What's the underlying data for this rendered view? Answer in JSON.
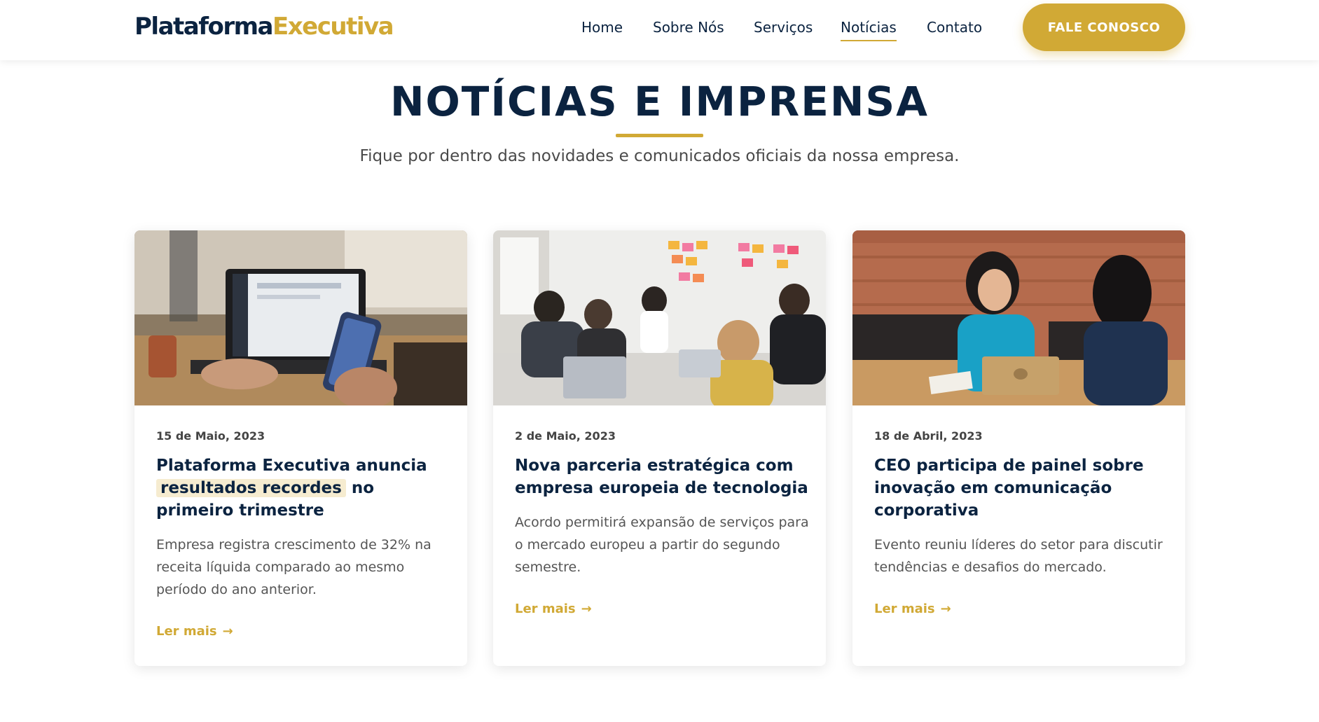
{
  "header": {
    "logo_part1": "Plataforma",
    "logo_part2": "Executiva",
    "nav": [
      {
        "label": "Home"
      },
      {
        "label": "Sobre Nós"
      },
      {
        "label": "Serviços"
      },
      {
        "label": "Notícias",
        "active": true
      },
      {
        "label": "Contato"
      }
    ],
    "cta_label": "FALE CONOSCO"
  },
  "hero": {
    "title": "NOTÍCIAS E IMPRENSA",
    "subtitle": "Fique por dentro das novidades e comunicados oficiais da nossa empresa."
  },
  "cards": [
    {
      "date": "15 de Maio, 2023",
      "headline_before": "Plataforma Executiva anuncia",
      "headline_highlight": "resultados recordes",
      "headline_after": "no primeiro trimestre",
      "excerpt": "Empresa registra crescimento de 32% na receita líquida comparado ao mesmo período do ano anterior.",
      "read_more": "Ler mais",
      "arrow_icon": "→"
    },
    {
      "date": "2 de Maio, 2023",
      "headline": "Nova parceria estratégica com empresa europeia de tecnologia",
      "excerpt": "Acordo permitirá expansão de serviços para o mercado europeu a partir do segundo semestre.",
      "read_more": "Ler mais",
      "arrow_icon": "→"
    },
    {
      "date": "18 de Abril, 2023",
      "headline": "CEO participa de painel sobre inovação em comunicação corporativa",
      "excerpt": "Evento reuniu líderes do setor para discutir tendências e desafios do mercado.",
      "read_more": "Ler mais",
      "arrow_icon": "→"
    }
  ],
  "colors": {
    "navy": "#0b2340",
    "gold": "#d1a935",
    "highlight": "#f6ecd0"
  }
}
